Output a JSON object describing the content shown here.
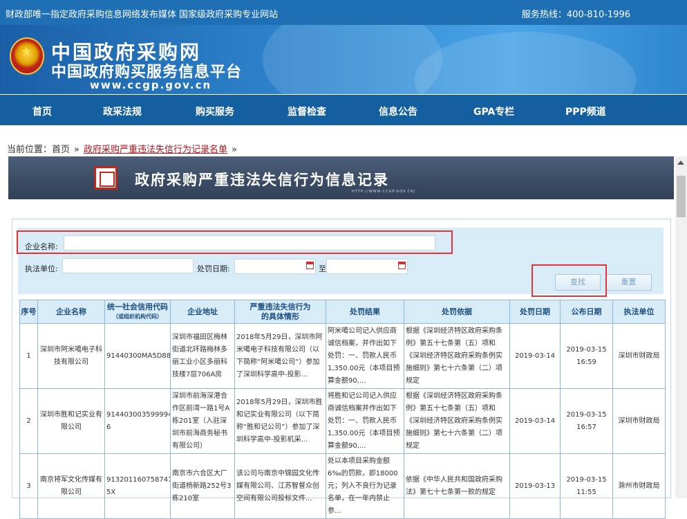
{
  "topbar": {
    "left_text": "财政部唯一指定政府采购信息网络发布媒体  国家级政府采购专业网站",
    "hotline": "服务热线：400-810-1996"
  },
  "banner": {
    "title_cn": "中国政府采购网",
    "subtitle_cn": "中国政府购买服务信息平台",
    "url": "www.ccgp.gov.cn"
  },
  "nav": {
    "items": [
      "首页",
      "政采法规",
      "购买服务",
      "监督检查",
      "信息公告",
      "GPA专栏",
      "PPP频道"
    ]
  },
  "breadcrumb": {
    "prefix": "当前位置：",
    "home": "首页",
    "current": "政府采购严重违法失信行为记录名单",
    "sep": "»"
  },
  "page_title": {
    "text": "政府采购严重违法失信行为信息记录",
    "url": "HTTP://WWW.CCGP.GOV.CN/"
  },
  "search": {
    "company_label": "企业名称:",
    "company_value": "",
    "unit_label": "执法单位:",
    "unit_value": "",
    "date_label": "处罚日期:",
    "date_from": "",
    "date_to_label": "至",
    "date_to": "",
    "search_button": "查找",
    "reset_button": "重置"
  },
  "table": {
    "headers": [
      {
        "label": "序号",
        "sub": ""
      },
      {
        "label": "企业名称",
        "sub": ""
      },
      {
        "label": "统一社会信用代码",
        "sub": "（或组织机构代码）"
      },
      {
        "label": "企业地址",
        "sub": ""
      },
      {
        "label": "严重违法失信行为",
        "sub": "的具体情形"
      },
      {
        "label": "处罚结果",
        "sub": ""
      },
      {
        "label": "处罚依据",
        "sub": ""
      },
      {
        "label": "处罚日期",
        "sub": ""
      },
      {
        "label": "公布日期",
        "sub": ""
      },
      {
        "label": "执法单位",
        "sub": ""
      }
    ],
    "rows": [
      {
        "no": "1",
        "name": "深圳市阿米噶电子科技有限公司",
        "code": "91440300MA5D88NU52",
        "address": "深圳市福田区梅林街道北环路梅林多丽工业小区多丽科技楼7层706A房",
        "situation": "2018年5月29日，深圳市阿米噶电子科技有限公司（以下简称“阿米噶公司”）参加了深圳科学高中-投影...",
        "result": "阿米噶公司记入供应商诚信档案，并作出如下处罚：一、罚款人民币1,350.00元（本项目预算金额90,...",
        "basis": "根据《深圳经济特区政府采购条例》第五十七条第（五）项和《深圳经济特区政府采购条例实施细则》第七十六条第（二）项规定",
        "penalty_date": "2019-03-14",
        "publish_date": "2019-03-15",
        "publish_time": "16:59",
        "unit": "深圳市财政局"
      },
      {
        "no": "2",
        "name": "深圳市胜和记实业有限公司",
        "code": "91440300359999439 6",
        "address": "深圳市前海深港合作区前湾一路1号A栋201室（入驻深圳市前海商务秘书有限公司）",
        "situation": "2018年5月29日，深圳市胜和记实业有限公司（以下简称“胜和记公司”）参加了深圳科学高中-投影机采...",
        "result": "将胜和记公司记入供应商诚信档案并作出如下处罚：一、罚款人民币1,350.00元（本项目预算金额90,...",
        "basis": "根据《深圳经济特区政府采购条例》第五十七条第（五）项和《深圳经济特区政府采购条例实施细则》第七十六条第（二）项规定",
        "penalty_date": "2019-03-14",
        "publish_date": "2019-03-15",
        "publish_time": "16:57",
        "unit": "深圳市财政局"
      },
      {
        "no": "3",
        "name": "南京将军文化传媒有限公司",
        "code": "9132011607587476 5X",
        "address": "南京市六合区大厂街道杨新路252号3栋210室",
        "situation": "该公司与南京中锦园文化传媒有限公司、江苏智督众创空间有限公司投标文件...",
        "result": "处以本项目采购金额6‰的罚款，即18000元；列入不良行为记录名单，在一年内禁止参...",
        "basis": "依据《中华人民共和国政府采购法》第七十七条第一款的规定",
        "penalty_date": "2019-03-13",
        "publish_date": "2019-03-15",
        "publish_time": "11:55",
        "unit": "滁州市财政局"
      }
    ]
  },
  "colors": {
    "topbar": "#1e6fb3",
    "nav": "#145f9f",
    "highlight_box": "#e23434",
    "link": "#1a4fa0",
    "breadcrumb_link": "#b3131b"
  }
}
